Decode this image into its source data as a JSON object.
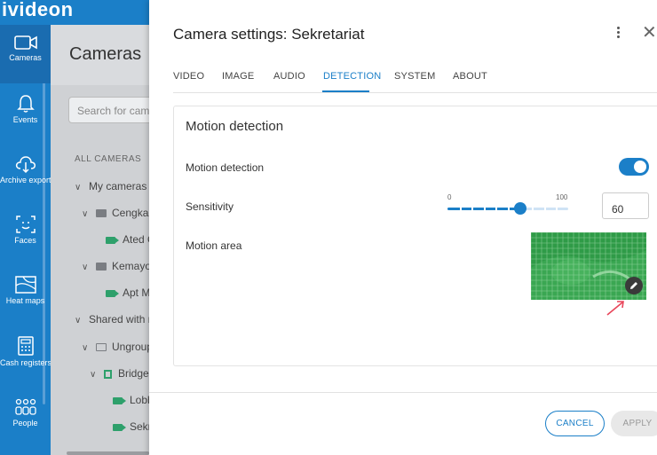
{
  "brand": {
    "name": "ivideon"
  },
  "nav": {
    "items": [
      {
        "label": "Cameras",
        "icon": "camera-icon"
      },
      {
        "label": "Events",
        "icon": "bell-icon"
      },
      {
        "label": "Archive export",
        "icon": "cloud-download-icon"
      },
      {
        "label": "Faces",
        "icon": "face-scan-icon"
      },
      {
        "label": "Heat maps",
        "icon": "heatmap-icon"
      },
      {
        "label": "Cash registers",
        "icon": "cash-register-icon"
      },
      {
        "label": "People",
        "icon": "people-icon"
      }
    ]
  },
  "cameras_panel": {
    "title": "Cameras",
    "search_placeholder": "Search for cameras",
    "section_label": "ALL CAMERAS",
    "tree": {
      "my_cameras": "My cameras",
      "folder1": "Cengkareng",
      "cam1": "Ated Cengkareng",
      "folder2": "Kemayoran",
      "cam2": "Apt Mediterania",
      "shared": "Shared with me",
      "ungrouped": "Ungrouped",
      "bridge": "Bridge",
      "cam3": "Lobby",
      "cam4": "Sekretariat"
    }
  },
  "dialog": {
    "title": "Camera settings: Sekretariat",
    "tabs": [
      "VIDEO",
      "IMAGE",
      "AUDIO",
      "DETECTION",
      "SYSTEM",
      "ABOUT"
    ],
    "active_tab": "DETECTION",
    "section_title": "Motion detection",
    "motion_detection_label": "Motion detection",
    "motion_detection_enabled": true,
    "sensitivity_label": "Sensitivity",
    "sensitivity_min": "0",
    "sensitivity_max": "100",
    "sensitivity_value": "60",
    "motion_area_label": "Motion area",
    "cancel_label": "CANCEL",
    "apply_label": "APPLY"
  },
  "colors": {
    "accent": "#1b7fc8",
    "camera_green": "#2ea06b",
    "motion_grid": "#2e9a46",
    "arrow": "#e8455a"
  }
}
